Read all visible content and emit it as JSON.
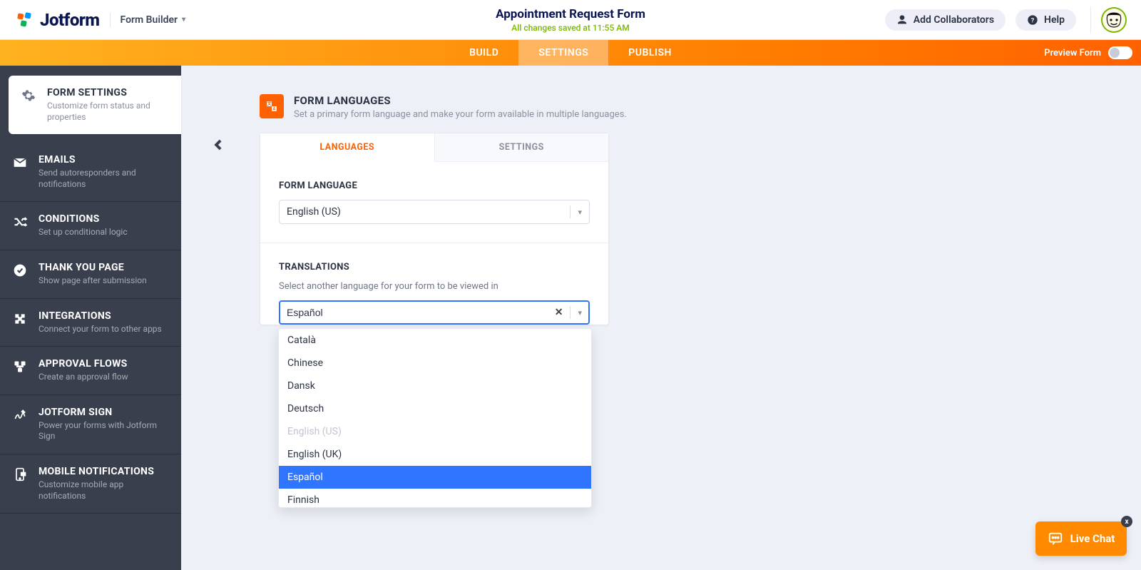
{
  "header": {
    "logo_text": "Jotform",
    "mode": "Form Builder",
    "title": "Appointment Request Form",
    "saved": "All changes saved at 11:55 AM",
    "collab": "Add Collaborators",
    "help": "Help"
  },
  "ribbon": {
    "tabs": [
      "BUILD",
      "SETTINGS",
      "PUBLISH"
    ],
    "active": 1,
    "preview": "Preview Form"
  },
  "sidebar": {
    "items": [
      {
        "title": "FORM SETTINGS",
        "sub": "Customize form status and properties",
        "icon": "gear",
        "active": true
      },
      {
        "title": "EMAILS",
        "sub": "Send autoresponders and notifications",
        "icon": "mail"
      },
      {
        "title": "CONDITIONS",
        "sub": "Set up conditional logic",
        "icon": "shuffle"
      },
      {
        "title": "THANK YOU PAGE",
        "sub": "Show page after submission",
        "icon": "check"
      },
      {
        "title": "INTEGRATIONS",
        "sub": "Connect your form to other apps",
        "icon": "puzzle"
      },
      {
        "title": "APPROVAL FLOWS",
        "sub": "Create an approval flow",
        "icon": "flow"
      },
      {
        "title": "JOTFORM SIGN",
        "sub": "Power your forms with Jotform Sign",
        "icon": "sign"
      },
      {
        "title": "MOBILE NOTIFICATIONS",
        "sub": "Customize mobile app notifications",
        "icon": "phone"
      }
    ]
  },
  "section": {
    "title": "FORM LANGUAGES",
    "sub": "Set a primary form language and make your form available in multiple languages."
  },
  "panel": {
    "tabs": [
      "LANGUAGES",
      "SETTINGS"
    ],
    "active": 0,
    "form_language": {
      "label": "FORM LANGUAGE",
      "value": "English (US)"
    },
    "translations": {
      "label": "TRANSLATIONS",
      "desc": "Select another language for your form to be viewed in",
      "value": "Español",
      "options": [
        {
          "label": "Català"
        },
        {
          "label": "Chinese"
        },
        {
          "label": "Dansk"
        },
        {
          "label": "Deutsch"
        },
        {
          "label": "English (US)",
          "disabled": true
        },
        {
          "label": "English (UK)"
        },
        {
          "label": "Español",
          "highlight": true
        },
        {
          "label": "Finnish"
        }
      ]
    }
  },
  "livechat": {
    "label": "Live Chat",
    "badge": "x"
  }
}
